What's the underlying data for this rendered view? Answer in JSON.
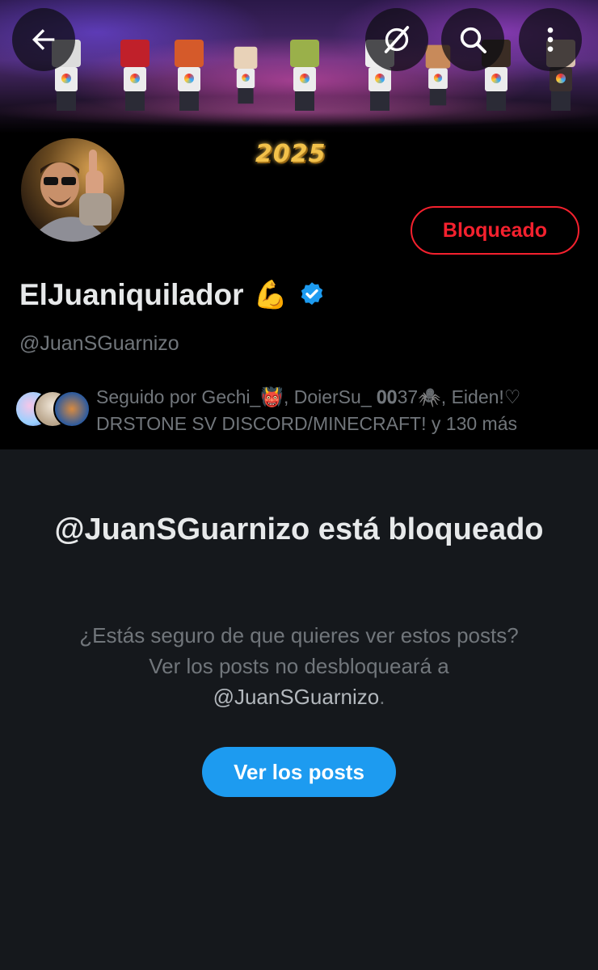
{
  "header": {
    "banner_year_text": "2025"
  },
  "profile": {
    "display_name": "ElJuaniquilador",
    "name_emoji": "💪",
    "verified": true,
    "handle": "@JuanSGuarnizo",
    "blocked_button_label": "Bloqueado",
    "followed_by_text": "Seguido por Gechi_👹, DoierSu_ 𝟎𝟎37🕷️, Eiden!♡ DRSTONE SV DISCORD/MINECRAFT! y 130 más"
  },
  "blocked_notice": {
    "title": "@JuanSGuarnizo está bloqueado",
    "description_prefix": "¿Estás seguro de que quieres ver estos posts? Ver los posts no desbloqueará a ",
    "description_handle": "@JuanSGuarnizo",
    "description_suffix": ".",
    "view_posts_label": "Ver los posts"
  },
  "colors": {
    "accent": "#1d9bf0",
    "blocked_red": "#f4212e",
    "muted_text": "#71767b"
  },
  "icons": {
    "back": "arrow-left-icon",
    "grok": "grok-icon",
    "search": "search-icon",
    "more": "more-vertical-icon",
    "verified": "verified-badge-icon"
  }
}
